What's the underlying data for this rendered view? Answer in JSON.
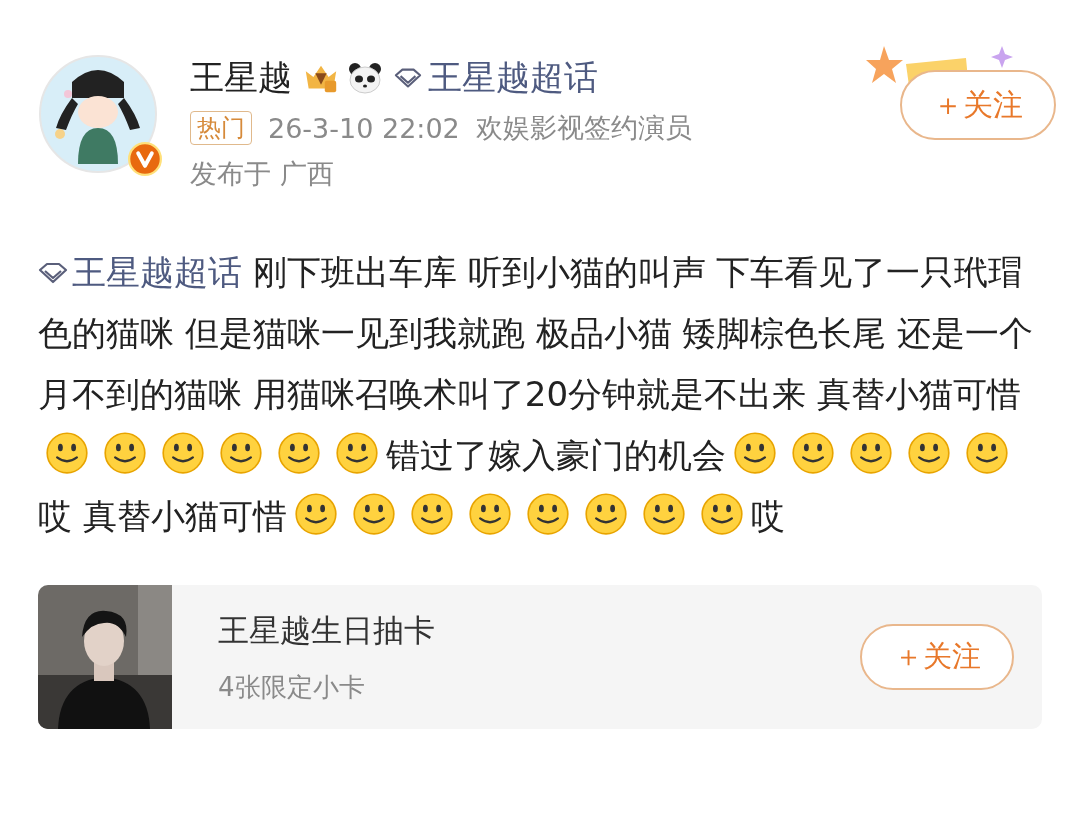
{
  "author": {
    "name": "王星越",
    "verified": true,
    "topic_link": "王星越超话",
    "follow_button": "＋关注"
  },
  "meta": {
    "hot_tag": "热门",
    "time": "26-3-10 22:02",
    "description": "欢娱影视签约演员",
    "location": "发布于 广西"
  },
  "body": [
    {
      "kind": "topic",
      "text": "王星越超话"
    },
    {
      "kind": "text",
      "text": " 刚下班出车库 听到小猫的叫声 下车看见了一只玳瑁色的猫咪 但是猫咪一见到我就跑 极品小猫 矮脚棕色长尾 还是一个月不到的猫咪 用猫咪召唤术叫了20分钟就是不出来 真替小猫可惜"
    },
    {
      "kind": "emoji"
    },
    {
      "kind": "emoji"
    },
    {
      "kind": "emoji"
    },
    {
      "kind": "emoji"
    },
    {
      "kind": "emoji"
    },
    {
      "kind": "emoji"
    },
    {
      "kind": "text",
      "text": "错过了嫁入豪门的机会"
    },
    {
      "kind": "emoji"
    },
    {
      "kind": "emoji"
    },
    {
      "kind": "emoji"
    },
    {
      "kind": "emoji"
    },
    {
      "kind": "emoji"
    },
    {
      "kind": "text",
      "text": "哎 真替小猫可惜"
    },
    {
      "kind": "emoji"
    },
    {
      "kind": "emoji"
    },
    {
      "kind": "emoji"
    },
    {
      "kind": "emoji"
    },
    {
      "kind": "emoji"
    },
    {
      "kind": "emoji"
    },
    {
      "kind": "emoji"
    },
    {
      "kind": "emoji"
    },
    {
      "kind": "text",
      "text": "哎"
    }
  ],
  "card": {
    "kind": "picture",
    "title": "王星越生日抽卡",
    "subtitle": "4张限定小卡",
    "follow_button": "＋关注"
  }
}
